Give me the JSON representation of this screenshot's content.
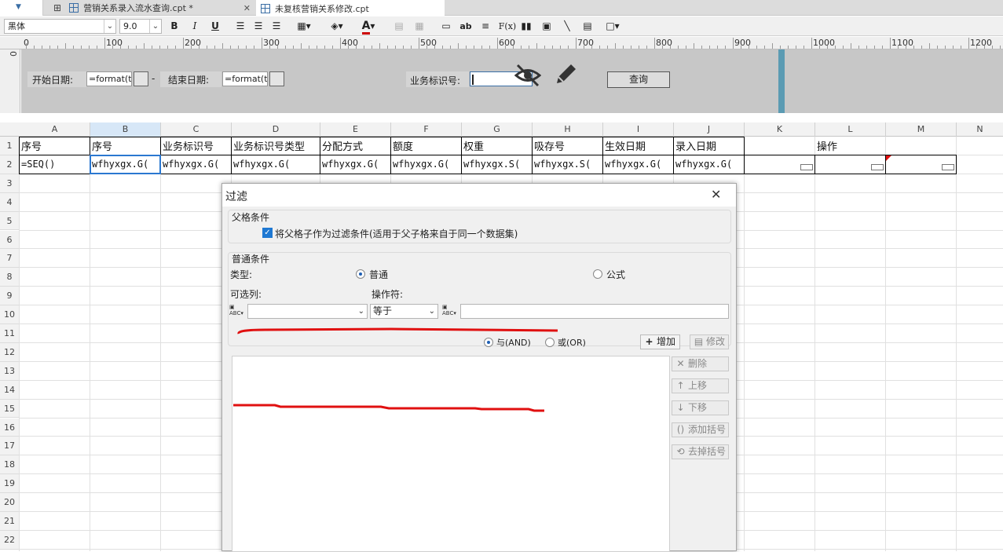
{
  "tabs": [
    {
      "label": "营销关系录入流水查询.cpt *",
      "active": false
    },
    {
      "label": "未复核营销关系修改.cpt",
      "active": true
    }
  ],
  "toolbar": {
    "font_family": "黑体",
    "font_size": "9.0",
    "bold": "B",
    "italic": "I",
    "underline": "U",
    "text_color_letter": "A",
    "text_color": "#cc0000",
    "text_tool": "ab",
    "formula_tool": "F(x)"
  },
  "ruler": {
    "zero": "0",
    "labels": [
      "100",
      "200",
      "300",
      "400",
      "500",
      "600",
      "700",
      "800",
      "900",
      "1000",
      "1100",
      "1200"
    ]
  },
  "vertical_ruler_label": "0",
  "param_panel": {
    "start_date_label": "开始日期:",
    "start_date_value": "=format(t",
    "dash": "-",
    "end_date_label": "结束日期:",
    "end_date_value": "=format(t",
    "biz_id_label": "业务标识号:",
    "biz_id_value": "",
    "query_button": "查询"
  },
  "grid": {
    "columns": [
      "A",
      "B",
      "C",
      "D",
      "E",
      "F",
      "G",
      "H",
      "I",
      "J",
      "K",
      "L",
      "M",
      "N"
    ],
    "selected_column": "B",
    "rows": [
      "1",
      "2",
      "3",
      "4",
      "5",
      "6",
      "7",
      "8",
      "9",
      "10",
      "11",
      "12",
      "13",
      "14",
      "15",
      "16",
      "17",
      "18",
      "19",
      "20",
      "21",
      "22"
    ],
    "row1": [
      "序号",
      "序号",
      "业务标识号",
      "业务标识号类型",
      "分配方式",
      "额度",
      "权重",
      "吸存号",
      "生效日期",
      "录入日期",
      "",
      "操作"
    ],
    "row2": [
      "=SEQ()",
      "wfhyxgx.G(",
      "wfhyxgx.G(",
      "wfhyxgx.G(",
      "wfhyxgx.G(",
      "wfhyxgx.G(",
      "wfhyxgx.S(",
      "wfhyxgx.S(",
      "wfhyxgx.G(",
      "wfhyxgx.G("
    ]
  },
  "dialog": {
    "title": "过滤",
    "close": "✕",
    "parent_section": {
      "title": "父格条件",
      "checkbox_label": "将父格子作为过滤条件(适用于父子格来自于同一个数据集)",
      "checked": true
    },
    "normal_section": {
      "title": "普通条件",
      "type_label": "类型:",
      "type_normal": "普通",
      "type_formula": "公式",
      "selected_type": "普通",
      "column_label": "可选列:",
      "column_value": "",
      "operator_label": "操作符:",
      "operator_value": "等于",
      "value_input": "",
      "and_label": "与(AND)",
      "or_label": "或(OR)",
      "selected_logic": "与(AND)"
    },
    "buttons": {
      "add": "增加",
      "modify": "修改",
      "delete": "删除",
      "move_up": "上移",
      "move_down": "下移",
      "add_bracket": "添加括号",
      "remove_bracket": "去掉括号"
    },
    "annotation_color": "#e01010"
  }
}
